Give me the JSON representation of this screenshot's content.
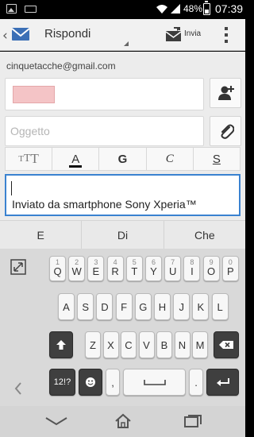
{
  "status_bar": {
    "battery_percent": "48%",
    "time": "07:39",
    "icons": [
      "image-notification-icon",
      "keyboard-notification-icon",
      "wifi-icon",
      "signal-icon",
      "battery-icon"
    ]
  },
  "action_bar": {
    "title": "Rispondi",
    "send_label": "Invia",
    "icons": [
      "back-icon",
      "email-app-icon",
      "send-icon",
      "overflow-menu-icon"
    ]
  },
  "compose": {
    "from": "cinquetacche@gmail.com",
    "subject_placeholder": "Oggetto",
    "body_text": "Inviato da smartphone Sony Xperia™",
    "format_buttons": {
      "bold": "G",
      "italic": "C",
      "underline": "S",
      "color_letter": "A",
      "size_small": "T",
      "size_mid": "T",
      "size_large": "T"
    },
    "icons": [
      "add-contact-icon",
      "attach-icon"
    ]
  },
  "suggestions": [
    "E",
    "Di",
    "Che"
  ],
  "keyboard": {
    "row1": [
      {
        "k": "Q",
        "s": "1"
      },
      {
        "k": "W",
        "s": "2"
      },
      {
        "k": "E",
        "s": "3"
      },
      {
        "k": "R",
        "s": "4"
      },
      {
        "k": "T",
        "s": "5"
      },
      {
        "k": "Y",
        "s": "6"
      },
      {
        "k": "U",
        "s": "7"
      },
      {
        "k": "I",
        "s": "8"
      },
      {
        "k": "O",
        "s": "9"
      },
      {
        "k": "P",
        "s": "0"
      }
    ],
    "row2": [
      "A",
      "S",
      "D",
      "F",
      "G",
      "H",
      "J",
      "K",
      "L"
    ],
    "row3": [
      "Z",
      "X",
      "C",
      "V",
      "B",
      "N",
      "M"
    ],
    "symbols": "12!?",
    "comma": ",",
    "period": ".",
    "icons": [
      "expand-icon",
      "shift-icon",
      "backspace-icon",
      "emoji-icon",
      "space-icon",
      "enter-icon",
      "hide-keyboard-icon"
    ]
  },
  "nav_bar": {
    "icons": [
      "nav-back-icon",
      "nav-home-icon",
      "nav-recents-icon"
    ]
  },
  "colors": {
    "accent": "#3a82d0",
    "recipient_chip": "#f4c4c6"
  }
}
